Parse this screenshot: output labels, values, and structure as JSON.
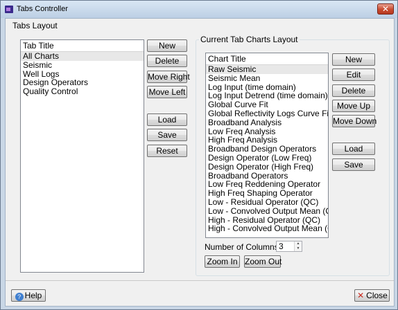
{
  "window": {
    "title": "Tabs Controller",
    "close_glyph": "✕"
  },
  "tabs_layout": {
    "group_label": "Tabs Layout",
    "list_header": "Tab Title",
    "items": [
      "All Charts",
      "Seismic",
      "Well Logs",
      "Design Operators",
      "Quality Control"
    ],
    "selected_index": 0,
    "buttons": {
      "new": "New",
      "delete": "Delete",
      "move_right": "Move Right",
      "move_left": "Move Left",
      "load": "Load",
      "save": "Save",
      "reset": "Reset"
    }
  },
  "chart_layout": {
    "group_label": "Current Tab Charts Layout",
    "list_header": "Chart Title",
    "items": [
      "Raw Seismic",
      "Seismic Mean",
      "Log Input (time domain)",
      "Log Input Detrend (time domain)",
      "Global Curve Fit",
      "Global Reflectivity Logs Curve Fit",
      "Broadband Analysis",
      "Low Freq Analysis",
      "High Freq Analysis",
      "Broadband Design Operators",
      "Design Operator (Low Freq)",
      "Design Operator (High Freq)",
      "Broadband Operators",
      "Low Freq Reddening Operator",
      "High Freq Shaping Operator",
      "Low - Residual Operator (QC)",
      "Low - Convolved Output Mean (QC)",
      "High - Residual Operator (QC)",
      "High - Convolved Output Mean (QC)"
    ],
    "selected_index": 0,
    "buttons": {
      "new": "New",
      "edit": "Edit",
      "delete": "Delete",
      "move_up": "Move Up",
      "move_down": "Move Down",
      "load": "Load",
      "save": "Save",
      "zoom_in": "Zoom In",
      "zoom_out": "Zoom Out"
    },
    "columns_label": "Number of Columns:",
    "columns_value": "3"
  },
  "footer": {
    "help": "Help",
    "close": "Close"
  },
  "icons": {
    "help": "help-icon",
    "close": "close-icon",
    "app": "app-icon"
  }
}
